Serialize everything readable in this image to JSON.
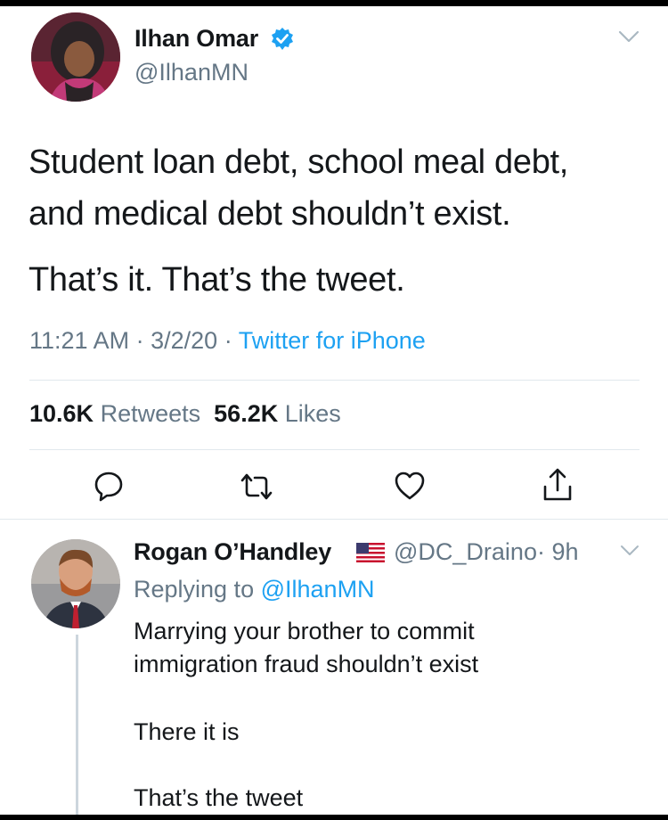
{
  "tweet": {
    "author_name": "Ilhan Omar",
    "author_handle": "@IlhanMN",
    "text_line1": "Student loan debt, school meal debt,",
    "text_line2": "and medical debt shouldn’t exist.",
    "text_line3": "That’s it. That’s the tweet.",
    "time": "11:21 AM",
    "date": "3/2/20",
    "separator": "·",
    "source": "Twitter for iPhone",
    "retweet_count": "10.6K",
    "retweet_label": "Retweets",
    "like_count": "56.2K",
    "like_label": "Likes"
  },
  "icons": {
    "verified": "verified-badge-icon",
    "reply": "reply-icon",
    "retweet": "retweet-icon",
    "like": "heart-icon",
    "share": "share-icon",
    "menu": "chevron-down-icon"
  },
  "reply": {
    "author_name": "Rogan O’Handley",
    "author_handle": "@DC_Draino",
    "age": "· 9h",
    "replying_label": "Replying to",
    "replying_to": "@IlhanMN",
    "line1": "Marrying your brother to commit",
    "line2": "immigration fraud shouldn’t exist",
    "line3": "There it is",
    "line4": "That’s the tweet"
  },
  "colors": {
    "link": "#1da1f2",
    "secondary_text": "#657786",
    "primary_text": "#14171a",
    "divider": "#e1e8ed"
  }
}
